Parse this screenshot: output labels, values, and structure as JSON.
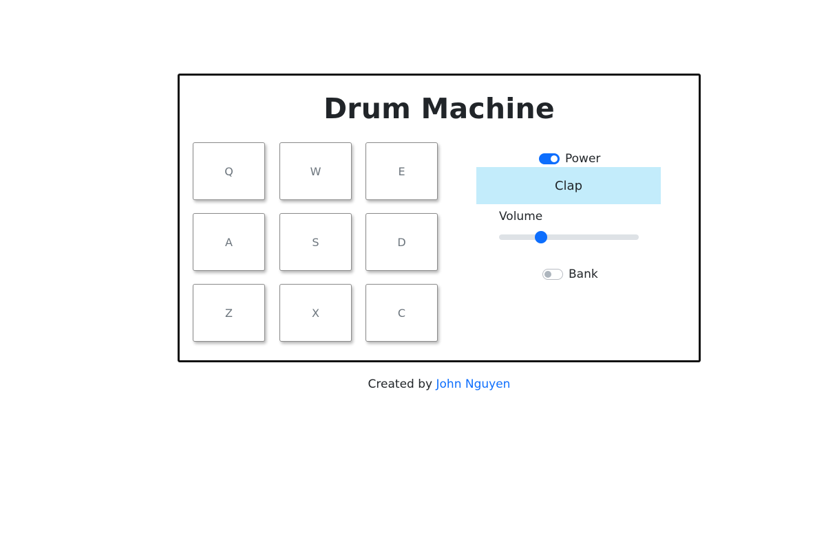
{
  "app": {
    "title": "Drum Machine"
  },
  "pads": [
    {
      "key": "Q"
    },
    {
      "key": "W"
    },
    {
      "key": "E"
    },
    {
      "key": "A"
    },
    {
      "key": "S"
    },
    {
      "key": "D"
    },
    {
      "key": "Z"
    },
    {
      "key": "X"
    },
    {
      "key": "C"
    }
  ],
  "controls": {
    "power": {
      "label": "Power",
      "on": true
    },
    "display": "Clap",
    "volume": {
      "label": "Volume",
      "value": 0.3
    },
    "bank": {
      "label": "Bank",
      "on": false
    }
  },
  "footer": {
    "prefix": "Created by",
    "author": "John Nguyen"
  },
  "colors": {
    "accent": "#0d6efd",
    "display_bg": "#c3ecfb",
    "border": "#111111"
  }
}
